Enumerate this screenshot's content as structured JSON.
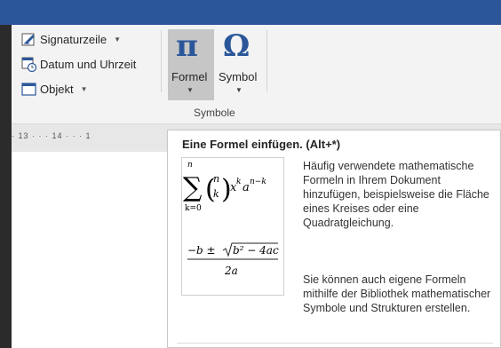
{
  "ribbon": {
    "items": [
      {
        "label": "Signaturzeile",
        "has_dropdown": true,
        "icon": "signature-line-icon"
      },
      {
        "label": "Datum und Uhrzeit",
        "has_dropdown": false,
        "icon": "date-time-icon"
      },
      {
        "label": "Objekt",
        "has_dropdown": true,
        "icon": "object-icon"
      }
    ],
    "formel": {
      "glyph": "π",
      "label": "Formel"
    },
    "symbol": {
      "glyph": "Ω",
      "label": "Symbol"
    },
    "group_label": "Symbole"
  },
  "ruler": {
    "ticks": "· 13 · · · 14 · · · 1"
  },
  "tooltip": {
    "title": "Eine Formel einfügen. (Alt+*)",
    "preview": {
      "sum_upper": "n",
      "sum_lower": "k=0",
      "binom_top": "n",
      "binom_bottom": "k",
      "x": "x",
      "k_exp": "k",
      "a": "a",
      "nk_exp": "n−k",
      "quad_numerator_left": "−b ± ",
      "quad_radicand": "b² − 4ac",
      "quad_denominator": "2a"
    },
    "desc1": "Häufig verwendete mathematische Formeln in Ihrem Dokument hinzufügen, beispielsweise die Fläche eines Kreises oder eine Quadratgleichung.",
    "desc2": "Sie können auch eigene Formeln mithilfe der Bibliothek mathematischer Symbole und Strukturen erstellen."
  },
  "colors": {
    "accent": "#2b579a",
    "title_bar": "#2b579a",
    "pressed": "#c6c6c6"
  }
}
